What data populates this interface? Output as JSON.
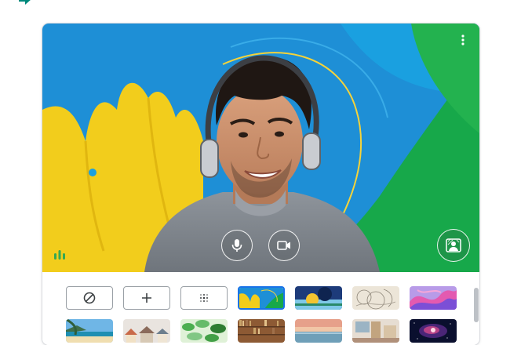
{
  "window": {
    "title": ""
  },
  "preview": {
    "more_options_icon": "more-vert-icon",
    "controls": [
      {
        "name": "microphone",
        "icon": "mic-icon",
        "state": "on"
      },
      {
        "name": "camera",
        "icon": "videocam-icon",
        "state": "on"
      }
    ],
    "effects_icon": "person-background-icon",
    "audio_indicator_icon": "audio-level-icon"
  },
  "backgrounds": {
    "row1": [
      {
        "kind": "none",
        "icon": "no-effect-icon"
      },
      {
        "kind": "upload",
        "icon": "plus-icon"
      },
      {
        "kind": "blur",
        "icon": "blur-dots-icon"
      },
      {
        "kind": "image",
        "theme": "yellow-blue-green abstract"
      },
      {
        "kind": "image",
        "theme": "navy yellow geometric"
      },
      {
        "kind": "image",
        "theme": "beige sketch"
      },
      {
        "kind": "image",
        "theme": "purple pink waves"
      }
    ],
    "row2": [
      {
        "kind": "image",
        "theme": "beach"
      },
      {
        "kind": "image",
        "theme": "houses"
      },
      {
        "kind": "image",
        "theme": "green foliage"
      },
      {
        "kind": "image",
        "theme": "bookshelf"
      },
      {
        "kind": "image",
        "theme": "sunset sea"
      },
      {
        "kind": "image",
        "theme": "office interior"
      },
      {
        "kind": "image",
        "theme": "galaxy"
      }
    ]
  },
  "colors": {
    "accent": "#1a73e8",
    "border": "#dadce0",
    "audio": "#34a853"
  }
}
